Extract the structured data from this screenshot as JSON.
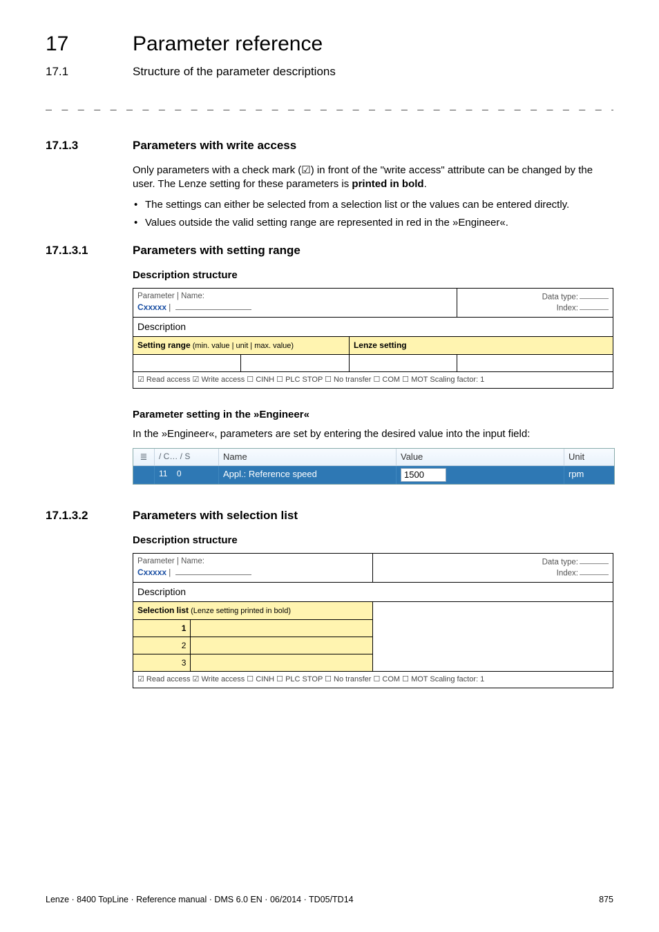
{
  "header": {
    "chapter_num": "17",
    "chapter_title": "Parameter reference",
    "sub_num": "17.1",
    "sub_title": "Structure of the parameter descriptions",
    "dashes": "_ _ _ _ _ _ _ _ _ _ _ _ _ _ _ _ _ _ _ _ _ _ _ _ _ _ _ _ _ _ _ _ _ _ _ _ _ _ _ _ _ _ _ _ _ _ _ _ _ _ _ _ _ _ _ _ _ _ _ _ _ _ _ _"
  },
  "s17_1_3": {
    "num": "17.1.3",
    "title": "Parameters with write access",
    "para1_a": "Only parameters with a check mark (",
    "para1_check": "☑",
    "para1_b": ") in front of the \"write access\" attribute can be changed by the user. The Lenze setting for these parameters is ",
    "para1_bold": "printed in bold",
    "para1_c": ".",
    "bullets": [
      "The settings can either be selected from a selection list or the values can be entered directly.",
      "Values outside the valid setting range are represented in red in the »Engineer«."
    ]
  },
  "s17_1_3_1": {
    "num": "17.1.3.1",
    "title": "Parameters with setting range",
    "desc_heading": "Description structure",
    "meta_label": "Parameter | Name:",
    "cxxxxx": "Cxxxxx",
    "meta_pipe": " | ",
    "dt_label": "Data type:",
    "idx_label": "Index:",
    "description_row": "Description",
    "yellow_left_main": "Setting range",
    "yellow_left_sub": " (min. value | unit | max. value)",
    "yellow_right": "Lenze setting",
    "attr_line": "☑ Read access   ☑ Write access   ☐ CINH   ☐ PLC STOP   ☐ No transfer   ☐ COM   ☐ MOT    Scaling factor: 1",
    "eng_heading": "Parameter setting in the »Engineer«",
    "eng_para": "In the »Engineer«, parameters are set by entering the desired value into the input field:",
    "eng_cols": {
      "flags": "  /   C… /  S",
      "name": "Name",
      "value": "Value",
      "unit": "Unit"
    },
    "eng_row": {
      "flags_num": "11",
      "flags_s": "0",
      "name": "Appl.: Reference speed",
      "value": "1500",
      "unit": "rpm"
    }
  },
  "s17_1_3_2": {
    "num": "17.1.3.2",
    "title": "Parameters with selection list",
    "desc_heading": "Description structure",
    "meta_label": "Parameter | Name:",
    "cxxxxx": "Cxxxxx",
    "meta_pipe": " | ",
    "dt_label": "Data type:",
    "idx_label": "Index:",
    "description_row": "Description",
    "yellow_left_main": "Selection list",
    "yellow_left_sub": " (Lenze setting printed in bold)",
    "rows": [
      "1",
      "2",
      "3"
    ],
    "attr_line": "☑ Read access   ☑ Write access   ☐ CINH   ☐ PLC STOP   ☐ No transfer   ☐ COM   ☐ MOT    Scaling factor: 1"
  },
  "footer": {
    "left": "Lenze · 8400 TopLine · Reference manual · DMS 6.0 EN · 06/2014 · TD05/TD14",
    "right": "875"
  }
}
